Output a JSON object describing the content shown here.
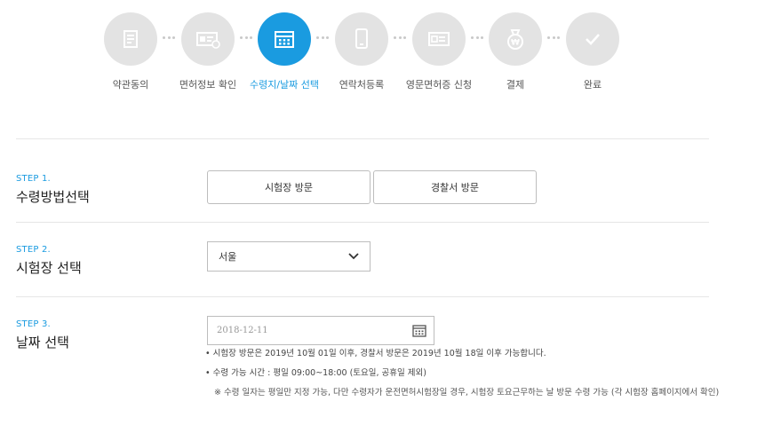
{
  "steps": [
    {
      "label": "약관동의",
      "icon": "document-icon"
    },
    {
      "label": "면허정보 확인",
      "icon": "license-card-icon"
    },
    {
      "label": "수령지/날짜 선택",
      "icon": "calendar-icon"
    },
    {
      "label": "연락처등록",
      "icon": "phone-icon"
    },
    {
      "label": "영문면허증 신청",
      "icon": "english-license-icon"
    },
    {
      "label": "결제",
      "icon": "money-bag-icon"
    },
    {
      "label": "완료",
      "icon": "check-icon"
    }
  ],
  "active_step_index": 2,
  "colors": {
    "accent": "#1a9be0",
    "inactive_circle": "#e3e3e3"
  },
  "step1": {
    "num": "STEP 1.",
    "title": "수령방법선택",
    "option_exam_site": "시험장 방문",
    "option_police": "경찰서 방문"
  },
  "step2": {
    "num": "STEP 2.",
    "title": "시험장 선택",
    "selected": "서울"
  },
  "step3": {
    "num": "STEP 3.",
    "title": "날짜 선택",
    "date_placeholder": "2018-12-11",
    "note1": "• 시험장 방문은 2019년 10월 01일 이후, 경찰서 방문은 2019년 10월 18일 이후 가능합니다.",
    "note2": "• 수령 가능 시간 : 평일 09:00~18:00 (토요일, 공휴일 제외)",
    "note3": "※ 수령 일자는 평일만 지정 가능, 다만 수령자가 운전면허시험장일 경우, 시험장 토요근무하는 날 방문 수령 가능 (각 시험장 홈페이지에서 확인)"
  }
}
